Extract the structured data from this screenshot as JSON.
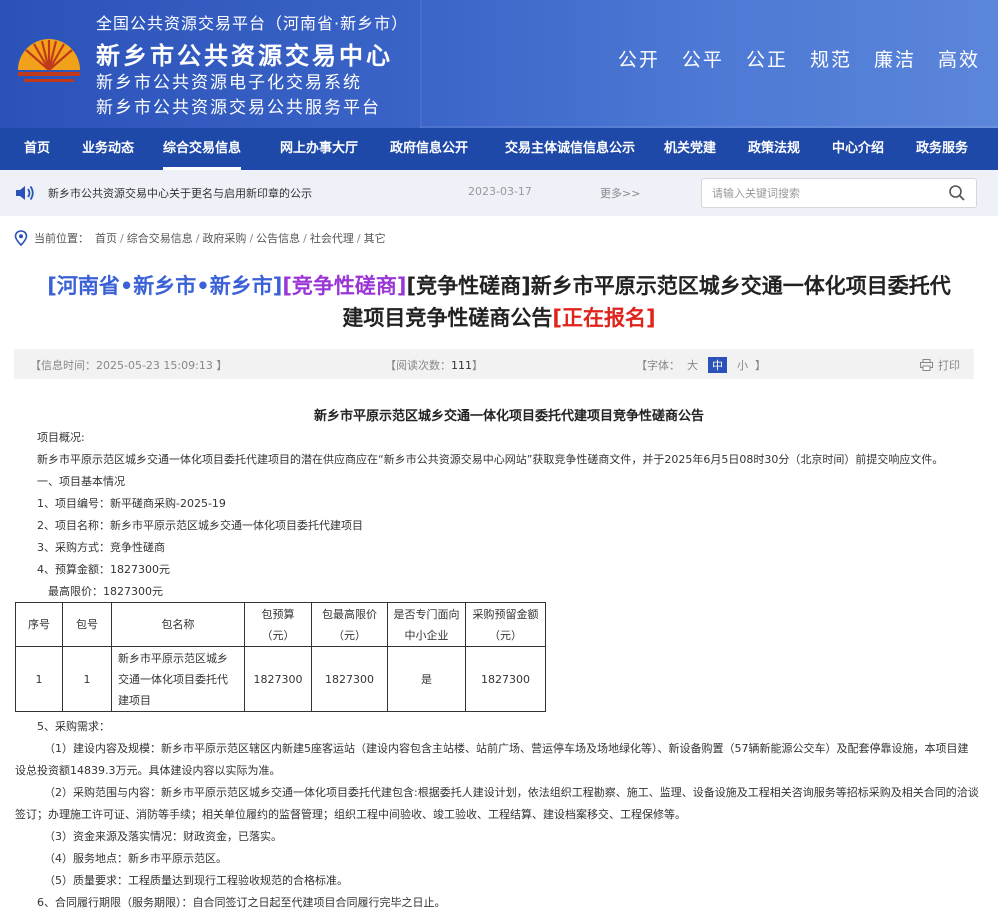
{
  "header": {
    "line1": "全国公共资源交易平台（河南省·新乡市）",
    "line2": "新乡市公共资源交易中心",
    "line3": "新乡市公共资源电子化交易系统",
    "line4": "新乡市公共资源交易公共服务平台",
    "slogans": [
      "公开",
      "公平",
      "公正",
      "规范",
      "廉洁",
      "高效"
    ]
  },
  "nav": {
    "items": [
      "首页",
      "业务动态",
      "综合交易信息",
      "网上办事大厅",
      "政府信息公开",
      "交易主体诚信信息公示",
      "机关党建",
      "政策法规",
      "中心介绍",
      "政务服务"
    ]
  },
  "notice": {
    "text": "新乡市公共资源交易中心关于更名与启用新印章的公示",
    "date": "2023-03-17",
    "more": "更多>>"
  },
  "search": {
    "placeholder": "请输入关键词搜索"
  },
  "breadcrumb": {
    "label": "当前位置：",
    "items": [
      "首页",
      "综合交易信息",
      "政府采购",
      "公告信息",
      "社会代理",
      "其它"
    ]
  },
  "title": {
    "seg1": "[河南省•新乡市•新乡市]",
    "seg2": "[竞争性磋商]",
    "seg3": "[竞争性磋商]新乡市平原示范区城乡交通一体化项目委托代",
    "seg4": "建项目竞争性磋商公告",
    "seg5": "[正在报名]"
  },
  "info": {
    "time": "【信息时间：2025-05-23 15:09:13 】",
    "reads_label": "【阅读次数：",
    "reads": "111",
    "reads_end": "】",
    "font_label": "【字体：",
    "sizes": [
      "大",
      "中",
      "小"
    ],
    "font_end": "】",
    "print": "打印"
  },
  "doc": {
    "title": "新乡市平原示范区城乡交通一体化项目委托代建项目竞争性磋商公告",
    "overview_label": "项目概况:",
    "overview": "新乡市平原示范区城乡交通一体化项目委托代建项目的潜在供应商应在“新乡市公共资源交易中心网站”获取竞争性磋商文件，并于2025年6月5日08时30分（北京时间）前提交响应文件。",
    "s1": "一、项目基本情况",
    "i1": "1、项目编号：新平磋商采购-2025-19",
    "i2": "2、项目名称：新乡市平原示范区城乡交通一体化项目委托代建项目",
    "i3": "3、采购方式：竞争性磋商",
    "i4": "4、预算金额：1827300元",
    "i4b": "最高限价：1827300元",
    "table": {
      "headers": [
        "序号",
        "包号",
        "包名称",
        "包预算\n（元）",
        "包最高限价\n（元）",
        "是否专门面向\n中小企业",
        "采购预留金额\n（元）"
      ],
      "row": [
        "1",
        "1",
        "新乡市平原示范区城乡交通一体化项目委托代建项目",
        "1827300",
        "1827300",
        "是",
        "1827300"
      ]
    },
    "i5": "5、采购需求：",
    "r1a": "（1）建设内容及规模：新乡市平原示范区辖区内新建5座客运站（建设内容包含主站楼、站前广场、营运停车场及场地绿化等）、新设备购置（57辆新能源公交车）及配套停靠设施，本项目建",
    "r1b": "设总投资额14839.3万元。具体建设内容以实际为准。",
    "r2a": "（2）采购范围与内容：新乡市平原示范区城乡交通一体化项目委托代建包含:根据委托人建设计划，依法组织工程勘察、施工、监理、设备设施及工程相关咨询服务等招标采购及相关合同的洽谈",
    "r2b": "签订；办理施工许可证、消防等手续；相关单位履约的监督管理；组织工程中间验收、竣工验收、工程结算、建设档案移交、工程保修等。",
    "r3": "（3）资金来源及落实情况：财政资金，已落实。",
    "r4": "（4）服务地点：新乡市平原示范区。",
    "r5": "（5）质量要求：工程质量达到现行工程验收规范的合格标准。",
    "i6": "6、合同履行期限（服务期限）：自合同签订之日起至代建项目合同履行完毕之日止。"
  },
  "colors": {
    "nav_bg": "#1f49a8",
    "title_blue": "#3a62d6",
    "title_purple": "#9b36d6",
    "title_red": "#e0241d"
  }
}
